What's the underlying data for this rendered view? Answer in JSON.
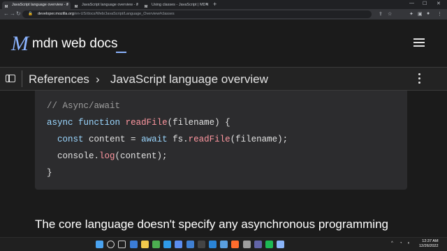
{
  "browser": {
    "tabs": [
      {
        "favicon": "M",
        "title": "JavaScript language overview - J",
        "active": true
      },
      {
        "favicon": "M",
        "title": "JavaScript language overview - J",
        "active": false
      },
      {
        "favicon": "M",
        "title": "Using classes - JavaScript | MDN",
        "active": false
      }
    ],
    "tab_close": "×",
    "new_tab": "+",
    "window_controls": {
      "minimize": "—",
      "maximize": "☐",
      "close": "✕"
    },
    "nav": {
      "back": "←",
      "forward": "→",
      "reload": "↻"
    },
    "url": {
      "domain": "developer.mozilla.org",
      "path": "/en-US/docs/Web/JavaScript/Language_Overview#classes"
    },
    "toolbar_icons": [
      "share-icon",
      "star-icon",
      "extensions-icon",
      "split-icon",
      "profile-icon",
      "menu-icon"
    ]
  },
  "mdn": {
    "logo_mark": "M",
    "logo_text": "mdn web docs",
    "breadcrumb": {
      "parent": "References",
      "separator": "›",
      "current": "JavaScript language overview"
    }
  },
  "code": {
    "comment": "// Async/await",
    "kw_async": "async",
    "kw_function": "function",
    "fn_name": "readFile",
    "params": "(filename) {",
    "kw_const": "const",
    "var_content": "content =",
    "kw_await": "await",
    "obj_fs": "fs.",
    "fn_readfile": "readFile",
    "arg_line": "(filename);",
    "console_obj": "console.",
    "fn_log": "log",
    "log_args": "(content);",
    "closing": "}"
  },
  "prose": {
    "text": "The core language doesn't specify any asynchronous programming"
  },
  "taskbar": {
    "apps": [
      "windows-start-icon",
      "search-icon",
      "task-view-icon",
      "widgets-icon",
      "file-explorer-icon",
      "chrome-icon",
      "edge-icon",
      "store-icon",
      "mail-icon",
      "terminal-icon",
      "vscode-icon",
      "photos-icon",
      "firefox-icon",
      "settings-icon",
      "teams-icon",
      "spotify-icon",
      "notepad-icon"
    ],
    "app_colors": [
      "#4aa3f0",
      "#d0d0d0",
      "#d0d0d0",
      "#3b7dd8",
      "#f2c94c",
      "#4caf50",
      "#2f9be8",
      "#5b8def",
      "#3f7fd1",
      "#444444",
      "#2a84d6",
      "#5aa0e0",
      "#ff6d2d",
      "#9e9e9e",
      "#6264a7",
      "#1db954",
      "#8ab4f8"
    ],
    "tray": {
      "chevron": "^",
      "wifi": "wifi-icon",
      "volume": "volume-icon"
    },
    "time": "12:37 AM",
    "date": "12/26/2022"
  },
  "colors": {
    "background": "#1b1b1b",
    "accent": "#8cb4ff",
    "code_bg": "#2c2c2e",
    "keyword": "#9bd7ff",
    "function": "#ff97a0"
  }
}
